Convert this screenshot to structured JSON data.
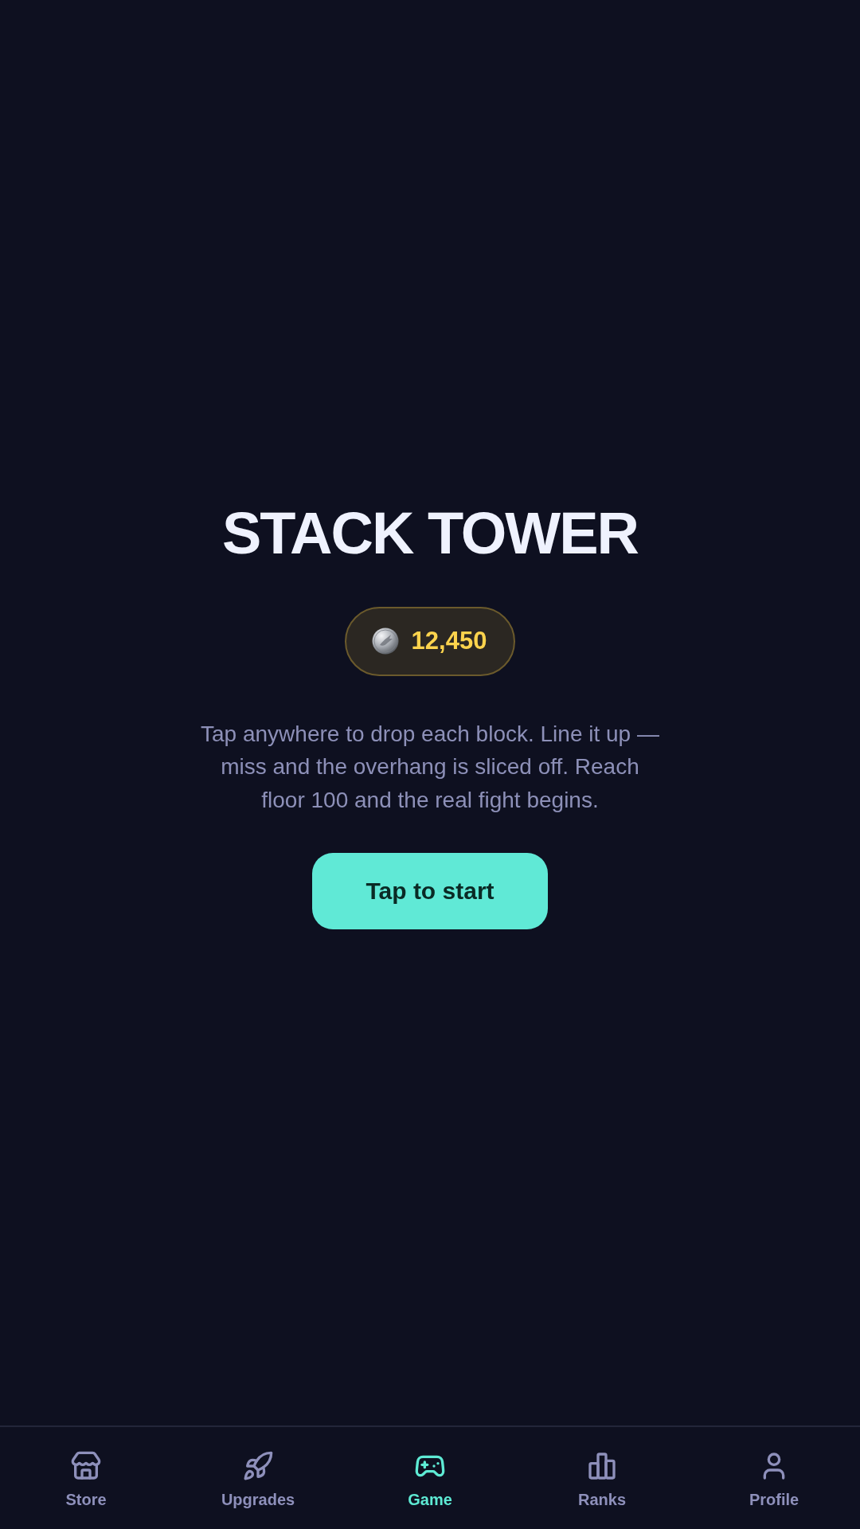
{
  "title": "STACK TOWER",
  "balance": {
    "amount": "12,450"
  },
  "description": "Tap anywhere to drop each block. Line it up — miss and the overhang is sliced off. Reach floor 100 and the real fight begins.",
  "start_button": {
    "label": "Tap to start"
  },
  "nav": {
    "items": [
      {
        "kind": "store",
        "label": "Store",
        "selected": false
      },
      {
        "kind": "upgrades",
        "label": "Upgrades",
        "selected": false
      },
      {
        "kind": "game",
        "label": "Game",
        "selected": true
      },
      {
        "kind": "ranks",
        "label": "Ranks",
        "selected": false
      },
      {
        "kind": "profile",
        "label": "Profile",
        "selected": false
      }
    ]
  }
}
